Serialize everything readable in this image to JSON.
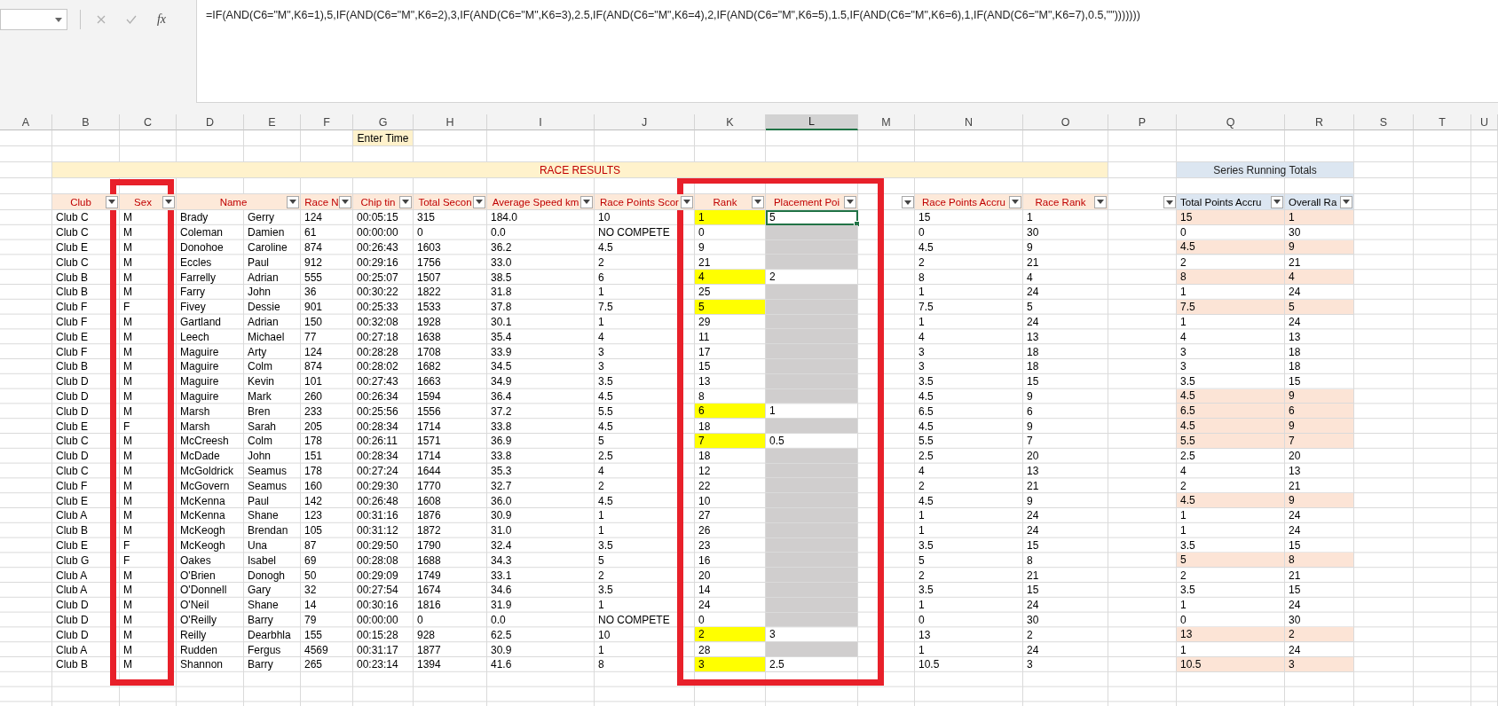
{
  "formula_bar": {
    "function_label": "fx",
    "formula": "=IF(AND(C6=\"M\",K6=1),5,IF(AND(C6=\"M\",K6=2),3,IF(AND(C6=\"M\",K6=3),2.5,IF(AND(C6=\"M\",K6=4),2,IF(AND(C6=\"M\",K6=5),1.5,IF(AND(C6=\"M\",K6=6),1,IF(AND(C6=\"M\",K6=7),0.5,\"\")))))))"
  },
  "column_letters": [
    {
      "label": "A",
      "selected": false
    },
    {
      "label": "B",
      "selected": false
    },
    {
      "label": "C",
      "selected": false
    },
    {
      "label": "D",
      "selected": false
    },
    {
      "label": "E",
      "selected": false
    },
    {
      "label": "F",
      "selected": false
    },
    {
      "label": "G",
      "selected": false
    },
    {
      "label": "H",
      "selected": false
    },
    {
      "label": "I",
      "selected": false
    },
    {
      "label": "J",
      "selected": false
    },
    {
      "label": "K",
      "selected": false
    },
    {
      "label": "L",
      "selected": true
    },
    {
      "label": "M",
      "selected": false
    },
    {
      "label": "N",
      "selected": false
    },
    {
      "label": "O",
      "selected": false
    },
    {
      "label": "P",
      "selected": false
    },
    {
      "label": "Q",
      "selected": false
    },
    {
      "label": "R",
      "selected": false
    },
    {
      "label": "S",
      "selected": false
    },
    {
      "label": "T",
      "selected": false
    },
    {
      "label": "U",
      "selected": false
    }
  ],
  "enter_time_label": "Enter Time",
  "race_results_title": "RACE RESULTS",
  "series_title": "Series Running Totals",
  "headers": [
    {
      "label": "Club",
      "kind": "results"
    },
    {
      "label": "Sex",
      "kind": "results"
    },
    {
      "label": "Name",
      "kind": "wide"
    },
    {
      "label": "Race N",
      "kind": "results"
    },
    {
      "label": "Chip tin",
      "kind": "results"
    },
    {
      "label": "Total Secon",
      "kind": "results"
    },
    {
      "label": "Average Speed km",
      "kind": "results"
    },
    {
      "label": "Race Points Scor",
      "kind": "results"
    },
    {
      "label": "Rank",
      "kind": "results"
    },
    {
      "label": "Placement Poi",
      "kind": "results"
    },
    {
      "kind": "blank"
    },
    {
      "label": "Race Points Accru",
      "kind": "results"
    },
    {
      "label": "Race Rank",
      "kind": "results"
    },
    {
      "kind": "blank"
    },
    {
      "label": "Total Points Accru",
      "kind": "totals"
    },
    {
      "label": "Overall Ra",
      "kind": "totals"
    }
  ],
  "rows": [
    {
      "cells": [
        "Club C",
        "M",
        "Brady",
        "Gerry",
        "124",
        "00:05:15",
        "315",
        "184.0",
        "10"
      ],
      "rank": "1",
      "rank_highlighted": true,
      "placement": {
        "value": "5",
        "selected": true
      },
      "accrued": [
        "15",
        "1"
      ],
      "totals": [
        "15",
        "1"
      ],
      "totals_highlighted": true
    },
    {
      "cells": [
        "Club C",
        "M",
        "Coleman",
        "Damien",
        "61",
        "00:00:00",
        "0",
        "0.0",
        "NO COMPETE"
      ],
      "rank": "0",
      "rank_highlighted": false,
      "accrued": [
        "0",
        "30"
      ],
      "totals": [
        "0",
        "30"
      ],
      "totals_highlighted": false
    },
    {
      "cells": [
        "Club E",
        "M",
        "Donohoe",
        "Caroline",
        "874",
        "00:26:43",
        "1603",
        "36.2",
        "4.5"
      ],
      "rank": "9",
      "rank_highlighted": false,
      "accrued": [
        "4.5",
        "9"
      ],
      "totals": [
        "4.5",
        "9"
      ],
      "totals_highlighted": true
    },
    {
      "cells": [
        "Club C",
        "M",
        "Eccles",
        "Paul",
        "912",
        "00:29:16",
        "1756",
        "33.0",
        "2"
      ],
      "rank": "21",
      "rank_highlighted": false,
      "accrued": [
        "2",
        "21"
      ],
      "totals": [
        "2",
        "21"
      ],
      "totals_highlighted": false
    },
    {
      "cells": [
        "Club B",
        "M",
        "Farrelly",
        "Adrian",
        "555",
        "00:25:07",
        "1507",
        "38.5",
        "6"
      ],
      "rank": "4",
      "rank_highlighted": true,
      "placement": {
        "value": "2",
        "selected": false
      },
      "accrued": [
        "8",
        "4"
      ],
      "totals": [
        "8",
        "4"
      ],
      "totals_highlighted": true
    },
    {
      "cells": [
        "Club B",
        "M",
        "Farry",
        "John",
        "36",
        "00:30:22",
        "1822",
        "31.8",
        "1"
      ],
      "rank": "25",
      "rank_highlighted": false,
      "accrued": [
        "1",
        "24"
      ],
      "totals": [
        "1",
        "24"
      ],
      "totals_highlighted": false
    },
    {
      "cells": [
        "Club F",
        "F",
        "Fivey",
        "Dessie",
        "901",
        "00:25:33",
        "1533",
        "37.8",
        "7.5"
      ],
      "rank": "5",
      "rank_highlighted": true,
      "accrued": [
        "7.5",
        "5"
      ],
      "totals": [
        "7.5",
        "5"
      ],
      "totals_highlighted": true
    },
    {
      "cells": [
        "Club F",
        "M",
        "Gartland",
        "Adrian",
        "150",
        "00:32:08",
        "1928",
        "30.1",
        "1"
      ],
      "rank": "29",
      "rank_highlighted": false,
      "accrued": [
        "1",
        "24"
      ],
      "totals": [
        "1",
        "24"
      ],
      "totals_highlighted": false
    },
    {
      "cells": [
        "Club E",
        "M",
        "Leech",
        "Michael",
        "77",
        "00:27:18",
        "1638",
        "35.4",
        "4"
      ],
      "rank": "11",
      "rank_highlighted": false,
      "accrued": [
        "4",
        "13"
      ],
      "totals": [
        "4",
        "13"
      ],
      "totals_highlighted": false
    },
    {
      "cells": [
        "Club F",
        "M",
        "Maguire",
        "Arty",
        "124",
        "00:28:28",
        "1708",
        "33.9",
        "3"
      ],
      "rank": "17",
      "rank_highlighted": false,
      "accrued": [
        "3",
        "18"
      ],
      "totals": [
        "3",
        "18"
      ],
      "totals_highlighted": false
    },
    {
      "cells": [
        "Club B",
        "M",
        "Maguire",
        "Colm",
        "874",
        "00:28:02",
        "1682",
        "34.5",
        "3"
      ],
      "rank": "15",
      "rank_highlighted": false,
      "accrued": [
        "3",
        "18"
      ],
      "totals": [
        "3",
        "18"
      ],
      "totals_highlighted": false
    },
    {
      "cells": [
        "Club D",
        "M",
        "Maguire",
        "Kevin",
        "101",
        "00:27:43",
        "1663",
        "34.9",
        "3.5"
      ],
      "rank": "13",
      "rank_highlighted": false,
      "accrued": [
        "3.5",
        "15"
      ],
      "totals": [
        "3.5",
        "15"
      ],
      "totals_highlighted": false
    },
    {
      "cells": [
        "Club D",
        "M",
        "Maguire",
        "Mark",
        "260",
        "00:26:34",
        "1594",
        "36.4",
        "4.5"
      ],
      "rank": "8",
      "rank_highlighted": false,
      "accrued": [
        "4.5",
        "9"
      ],
      "totals": [
        "4.5",
        "9"
      ],
      "totals_highlighted": true
    },
    {
      "cells": [
        "Club D",
        "M",
        "Marsh",
        "Bren",
        "233",
        "00:25:56",
        "1556",
        "37.2",
        "5.5"
      ],
      "rank": "6",
      "rank_highlighted": true,
      "placement": {
        "value": "1",
        "selected": false
      },
      "accrued": [
        "6.5",
        "6"
      ],
      "totals": [
        "6.5",
        "6"
      ],
      "totals_highlighted": true
    },
    {
      "cells": [
        "Club E",
        "F",
        "Marsh",
        "Sarah",
        "205",
        "00:28:34",
        "1714",
        "33.8",
        "4.5"
      ],
      "rank": "18",
      "rank_highlighted": false,
      "accrued": [
        "4.5",
        "9"
      ],
      "totals": [
        "4.5",
        "9"
      ],
      "totals_highlighted": true
    },
    {
      "cells": [
        "Club C",
        "M",
        "McCreesh",
        "Colm",
        "178",
        "00:26:11",
        "1571",
        "36.9",
        "5"
      ],
      "rank": "7",
      "rank_highlighted": true,
      "placement": {
        "value": "0.5",
        "selected": false
      },
      "accrued": [
        "5.5",
        "7"
      ],
      "totals": [
        "5.5",
        "7"
      ],
      "totals_highlighted": true
    },
    {
      "cells": [
        "Club D",
        "M",
        "McDade",
        "John",
        "151",
        "00:28:34",
        "1714",
        "33.8",
        "2.5"
      ],
      "rank": "18",
      "rank_highlighted": false,
      "accrued": [
        "2.5",
        "20"
      ],
      "totals": [
        "2.5",
        "20"
      ],
      "totals_highlighted": false
    },
    {
      "cells": [
        "Club C",
        "M",
        "McGoldrick",
        "Seamus",
        "178",
        "00:27:24",
        "1644",
        "35.3",
        "4"
      ],
      "rank": "12",
      "rank_highlighted": false,
      "accrued": [
        "4",
        "13"
      ],
      "totals": [
        "4",
        "13"
      ],
      "totals_highlighted": false
    },
    {
      "cells": [
        "Club F",
        "M",
        "McGovern",
        "Seamus",
        "160",
        "00:29:30",
        "1770",
        "32.7",
        "2"
      ],
      "rank": "22",
      "rank_highlighted": false,
      "accrued": [
        "2",
        "21"
      ],
      "totals": [
        "2",
        "21"
      ],
      "totals_highlighted": false
    },
    {
      "cells": [
        "Club E",
        "M",
        "McKenna",
        "Paul",
        "142",
        "00:26:48",
        "1608",
        "36.0",
        "4.5"
      ],
      "rank": "10",
      "rank_highlighted": false,
      "accrued": [
        "4.5",
        "9"
      ],
      "totals": [
        "4.5",
        "9"
      ],
      "totals_highlighted": true
    },
    {
      "cells": [
        "Club A",
        "M",
        "McKenna",
        "Shane",
        "123",
        "00:31:16",
        "1876",
        "30.9",
        "1"
      ],
      "rank": "27",
      "rank_highlighted": false,
      "accrued": [
        "1",
        "24"
      ],
      "totals": [
        "1",
        "24"
      ],
      "totals_highlighted": false
    },
    {
      "cells": [
        "Club B",
        "M",
        "McKeogh",
        "Brendan",
        "105",
        "00:31:12",
        "1872",
        "31.0",
        "1"
      ],
      "rank": "26",
      "rank_highlighted": false,
      "accrued": [
        "1",
        "24"
      ],
      "totals": [
        "1",
        "24"
      ],
      "totals_highlighted": false
    },
    {
      "cells": [
        "Club E",
        "F",
        "McKeogh",
        "Una",
        "87",
        "00:29:50",
        "1790",
        "32.4",
        "3.5"
      ],
      "rank": "23",
      "rank_highlighted": false,
      "accrued": [
        "3.5",
        "15"
      ],
      "totals": [
        "3.5",
        "15"
      ],
      "totals_highlighted": false
    },
    {
      "cells": [
        "Club G",
        "F",
        "Oakes",
        "Isabel",
        "69",
        "00:28:08",
        "1688",
        "34.3",
        "5"
      ],
      "rank": "16",
      "rank_highlighted": false,
      "accrued": [
        "5",
        "8"
      ],
      "totals": [
        "5",
        "8"
      ],
      "totals_highlighted": true
    },
    {
      "cells": [
        "Club A",
        "M",
        "O'Brien",
        "Donogh",
        "50",
        "00:29:09",
        "1749",
        "33.1",
        "2"
      ],
      "rank": "20",
      "rank_highlighted": false,
      "accrued": [
        "2",
        "21"
      ],
      "totals": [
        "2",
        "21"
      ],
      "totals_highlighted": false
    },
    {
      "cells": [
        "Club A",
        "M",
        "O'Donnell",
        "Gary",
        "32",
        "00:27:54",
        "1674",
        "34.6",
        "3.5"
      ],
      "rank": "14",
      "rank_highlighted": false,
      "accrued": [
        "3.5",
        "15"
      ],
      "totals": [
        "3.5",
        "15"
      ],
      "totals_highlighted": false
    },
    {
      "cells": [
        "Club D",
        "M",
        "O'Neil",
        "Shane",
        "14",
        "00:30:16",
        "1816",
        "31.9",
        "1"
      ],
      "rank": "24",
      "rank_highlighted": false,
      "accrued": [
        "1",
        "24"
      ],
      "totals": [
        "1",
        "24"
      ],
      "totals_highlighted": false
    },
    {
      "cells": [
        "Club D",
        "M",
        "O'Reilly",
        "Barry",
        "79",
        "00:00:00",
        "0",
        "0.0",
        "NO COMPETE"
      ],
      "rank": "0",
      "rank_highlighted": false,
      "accrued": [
        "0",
        "30"
      ],
      "totals": [
        "0",
        "30"
      ],
      "totals_highlighted": false
    },
    {
      "cells": [
        "Club D",
        "M",
        "Reilly",
        "Dearbhla",
        "155",
        "00:15:28",
        "928",
        "62.5",
        "10"
      ],
      "rank": "2",
      "rank_highlighted": true,
      "placement": {
        "value": "3",
        "selected": false
      },
      "accrued": [
        "13",
        "2"
      ],
      "totals": [
        "13",
        "2"
      ],
      "totals_highlighted": true
    },
    {
      "cells": [
        "Club A",
        "M",
        "Rudden",
        "Fergus",
        "4569",
        "00:31:17",
        "1877",
        "30.9",
        "1"
      ],
      "rank": "28",
      "rank_highlighted": false,
      "accrued": [
        "1",
        "24"
      ],
      "totals": [
        "1",
        "24"
      ],
      "totals_highlighted": false
    },
    {
      "cells": [
        "Club B",
        "M",
        "Shannon",
        "Barry",
        "265",
        "00:23:14",
        "1394",
        "41.6",
        "8"
      ],
      "rank": "3",
      "rank_highlighted": true,
      "placement": {
        "value": "2.5",
        "selected": false
      },
      "accrued": [
        "10.5",
        "3"
      ],
      "totals": [
        "10.5",
        "3"
      ],
      "totals_highlighted": true
    }
  ]
}
